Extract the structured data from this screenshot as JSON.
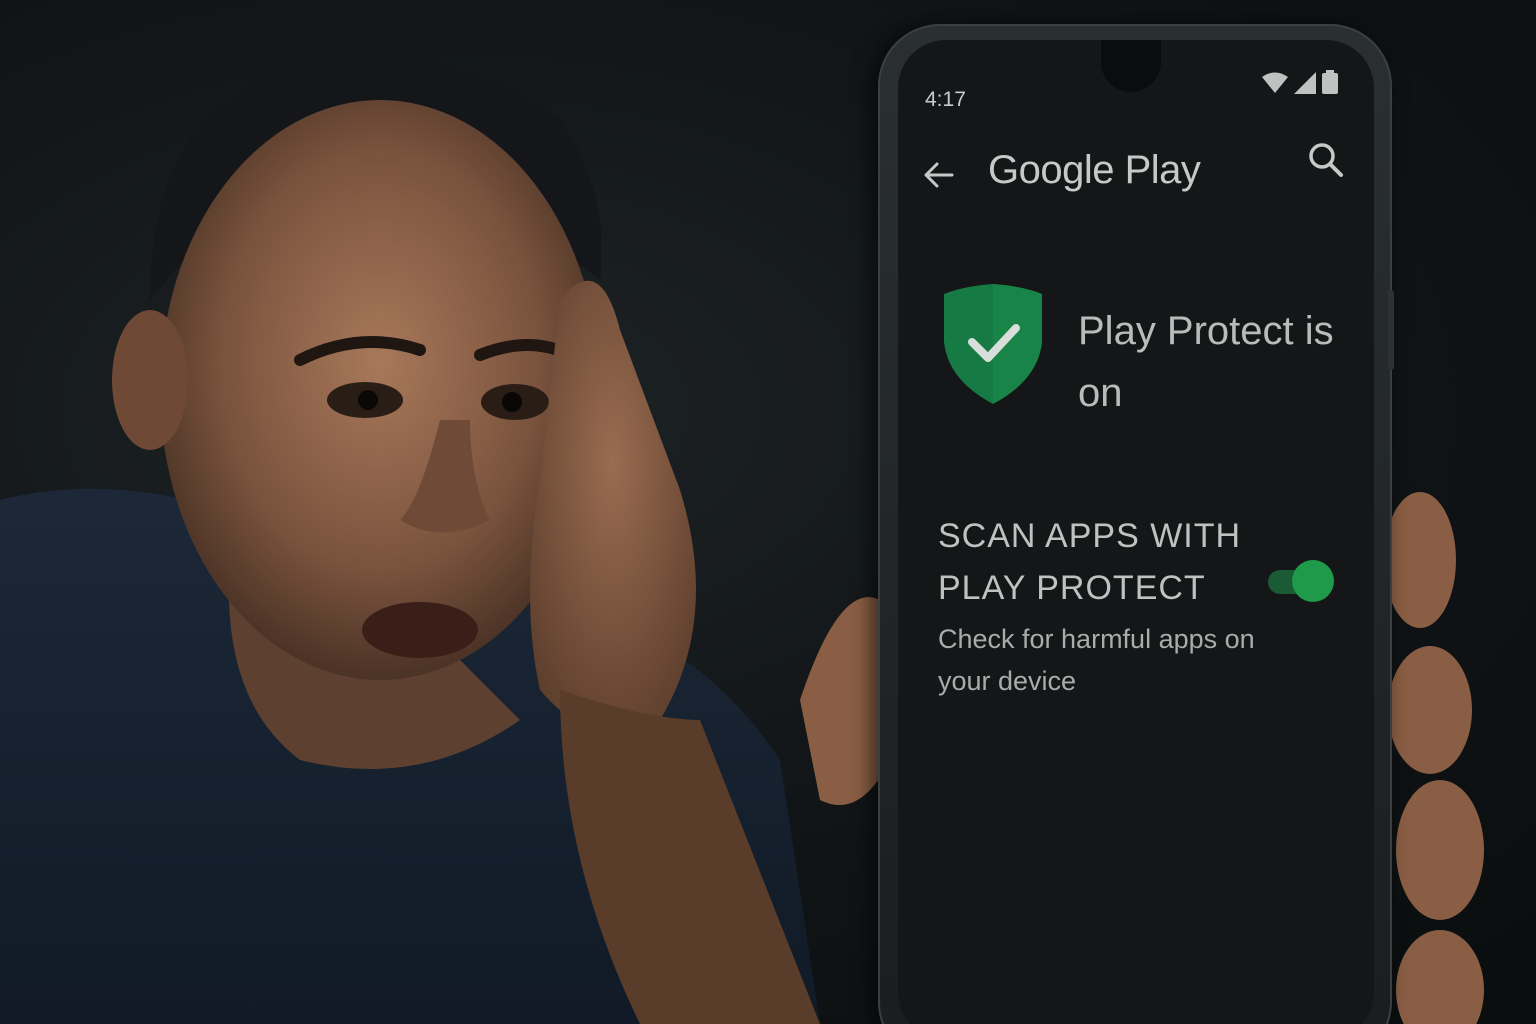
{
  "status_bar": {
    "time": "4:17",
    "icons": [
      "wifi-icon",
      "cellular-signal-icon",
      "battery-icon"
    ]
  },
  "app_bar": {
    "title": "Google Play",
    "back_icon": "arrow-left-icon",
    "search_icon": "search-icon"
  },
  "protect": {
    "icon": "shield-check-icon",
    "status": "Play Protect is on"
  },
  "scan_setting": {
    "title": "SCAN APPS WITH PLAY PROTECT",
    "description": "Check for harmful apps on your device",
    "enabled": true
  },
  "colors": {
    "accent_green": "#1e9a4a",
    "shield_green": "#157a43",
    "screen_bg": "#141617"
  }
}
